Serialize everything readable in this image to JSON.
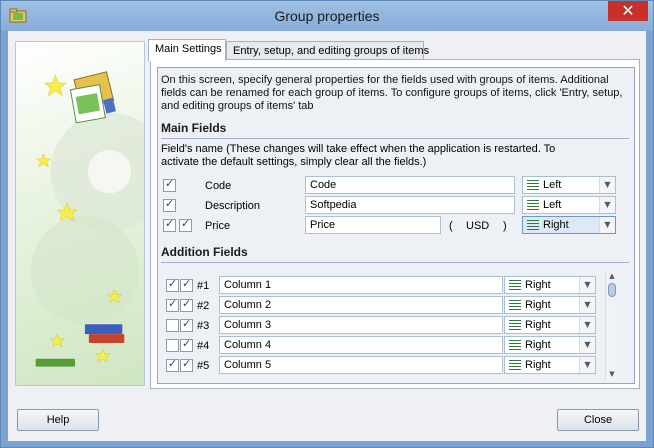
{
  "window": {
    "title": "Group properties",
    "close_glyph": "✕"
  },
  "tabs": [
    {
      "label": "Main Settings",
      "active": true
    },
    {
      "label": "Entry, setup, and editing groups of items",
      "active": false
    }
  ],
  "description": "On this screen, specify general properties for the fields used with groups of items. Additional fields can be renamed for each group of items. To configure groups of items, click 'Entry, setup, and editing groups of items' tab",
  "main_fields": {
    "title": "Main Fields",
    "note": "Field's name (These changes will take effect when the application is restarted. To activate the default settings, simply clear all the fields.)",
    "rows": [
      {
        "label": "Code",
        "value": "Code",
        "align": "Left"
      },
      {
        "label": "Description",
        "value": "Softpedia",
        "align": "Left"
      },
      {
        "label": "Price",
        "value": "Price",
        "align": "Right",
        "currency_open": "(",
        "currency": "USD",
        "currency_close": ")"
      }
    ]
  },
  "addition_fields": {
    "title": "Addition Fields",
    "rows": [
      {
        "num": "#1",
        "value": "Column 1",
        "align": "Right"
      },
      {
        "num": "#2",
        "value": "Column 2",
        "align": "Right"
      },
      {
        "num": "#3",
        "value": "Column 3",
        "align": "Right"
      },
      {
        "num": "#4",
        "value": "Column 4",
        "align": "Right"
      },
      {
        "num": "#5",
        "value": "Column 5",
        "align": "Right"
      }
    ]
  },
  "buttons": {
    "help": "Help",
    "close": "Close"
  },
  "icons": {
    "app": "folder-icon",
    "align": "align-lines-icon",
    "dropdown": "chevron-down-icon"
  },
  "colors": {
    "accent": "#6a97d0",
    "titlebar": "#9ec0e5",
    "close": "#c7302b"
  }
}
